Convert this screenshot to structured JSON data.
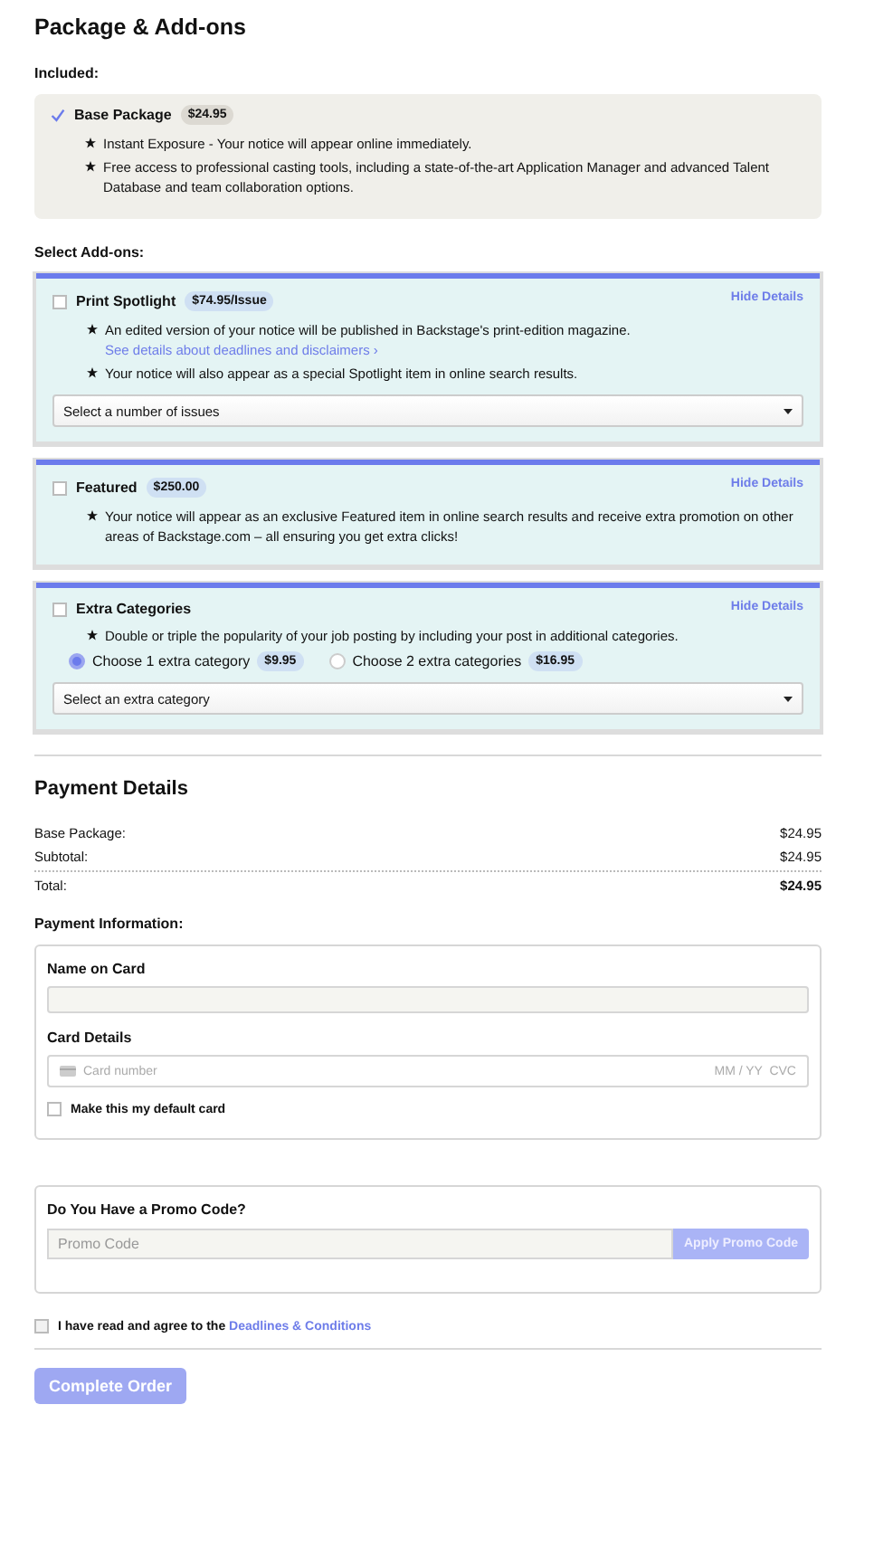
{
  "title": "Package & Add-ons",
  "included": {
    "label": "Included:",
    "checked": true,
    "name": "Base Package",
    "price": "$24.95",
    "features": [
      {
        "text": "Instant Exposure - Your notice will appear online immediately."
      },
      {
        "text": "Free access to professional casting tools, including a state-of-the-art Application Manager and advanced Talent Database and team collaboration options."
      }
    ]
  },
  "addons_label": "Select Add-ons:",
  "addons": [
    {
      "checked": false,
      "name": "Print Spotlight",
      "price": "$74.95/Issue",
      "toggle": "Hide Details",
      "features": [
        {
          "text": "An edited version of your notice will be published in Backstage's print-edition magazine.",
          "link": "See details about deadlines and disclaimers ›"
        },
        {
          "text": "Your notice will also appear as a special Spotlight item in online search results."
        }
      ],
      "select": "Select a number of issues"
    },
    {
      "checked": false,
      "name": "Featured",
      "price": "$250.00",
      "toggle": "Hide Details",
      "features": [
        {
          "text": "Your notice will appear as an exclusive Featured item in online search results and receive extra promotion on other areas of Backstage.com – all ensuring you get extra clicks!"
        }
      ]
    },
    {
      "checked": false,
      "name": "Extra Categories",
      "toggle": "Hide Details",
      "features": [
        {
          "text": "Double or triple the popularity of your job posting by including your post in additional categories."
        }
      ],
      "options": [
        {
          "label": "Choose 1 extra category",
          "price": "$9.95",
          "selected": true
        },
        {
          "label": "Choose 2 extra categories",
          "price": "$16.95",
          "selected": false
        }
      ],
      "select": "Select an extra category"
    }
  ],
  "payment": {
    "title": "Payment Details",
    "rows": [
      {
        "label": "Base Package:",
        "value": "$24.95",
        "kind": "line"
      },
      {
        "label": "Subtotal:",
        "value": "$24.95",
        "kind": "line"
      },
      {
        "label": "Total:",
        "value": "$24.95",
        "kind": "total"
      }
    ],
    "info_label": "Payment Information:",
    "name_label": "Name on Card",
    "details_label": "Card Details",
    "card_placeholder": "Card number",
    "expiry_placeholder": "MM / YY  CVC",
    "default_card": {
      "label": "Make this my default card",
      "checked": false
    }
  },
  "promo": {
    "title": "Do You Have a Promo Code?",
    "placeholder": "Promo Code",
    "button": "Apply Promo Code",
    "disabled": true
  },
  "agree": {
    "text": "I have read and agree to the",
    "link": "Deadlines & Conditions",
    "checked": false
  },
  "submit": {
    "label": "Complete Order",
    "disabled": true
  }
}
